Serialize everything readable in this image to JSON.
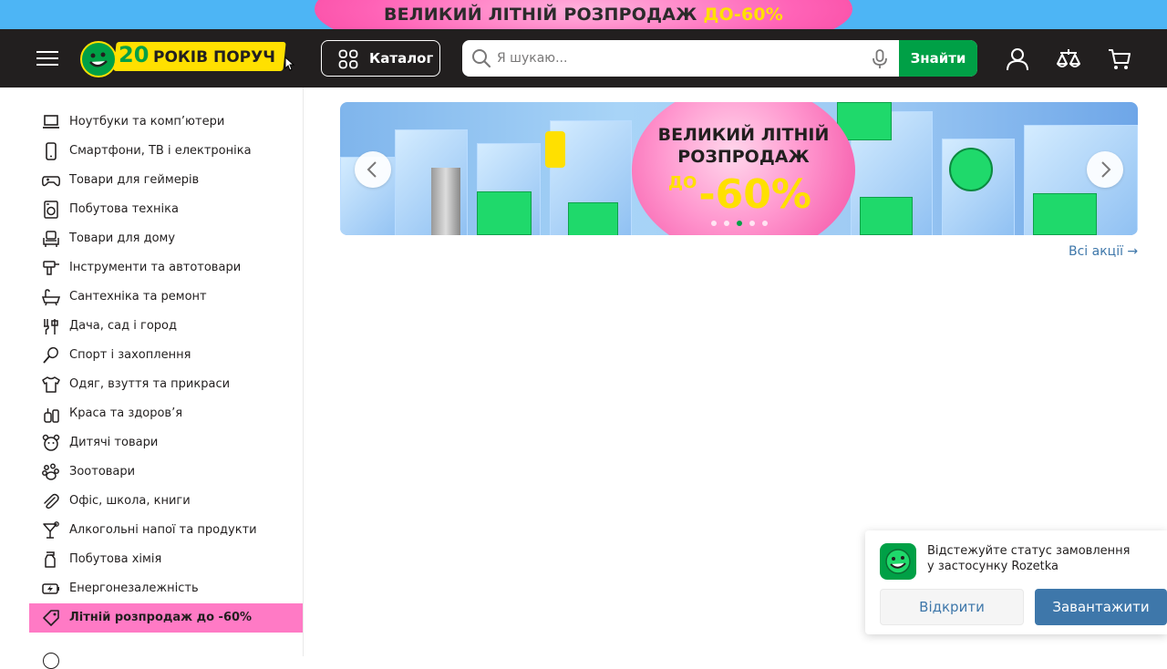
{
  "promo": {
    "text": "ВЕЛИКИЙ ЛІТНІЙ РОЗПРОДАЖ",
    "highlight": "ДО-60%"
  },
  "header": {
    "logo_number": "20",
    "logo_text": "РОКІВ ПОРУЧ",
    "catalog_label": "Каталог",
    "search_placeholder": "Я шукаю...",
    "search_button": "Знайти",
    "icons": [
      "menu-icon",
      "user-icon",
      "compare-icon",
      "cart-icon"
    ]
  },
  "sidebar": {
    "items": [
      {
        "label": "Ноутбуки та комп’ютери",
        "icon": "laptop-icon"
      },
      {
        "label": "Смартфони, ТВ і електроніка",
        "icon": "smartphone-icon"
      },
      {
        "label": "Товари для геймерів",
        "icon": "gamepad-icon"
      },
      {
        "label": "Побутова техніка",
        "icon": "washing-machine-icon"
      },
      {
        "label": "Товари для дому",
        "icon": "sofa-icon"
      },
      {
        "label": "Інструменти та автотовари",
        "icon": "drill-icon"
      },
      {
        "label": "Сантехніка та ремонт",
        "icon": "bathtub-icon"
      },
      {
        "label": "Дача, сад і город",
        "icon": "garden-fork-icon"
      },
      {
        "label": "Спорт і захоплення",
        "icon": "racket-icon"
      },
      {
        "label": "Одяг, взуття та прикраси",
        "icon": "tshirt-icon"
      },
      {
        "label": "Краса та здоров’я",
        "icon": "beauty-bottle-icon"
      },
      {
        "label": "Дитячі товари",
        "icon": "teddy-bear-icon"
      },
      {
        "label": "Зоотовари",
        "icon": "paw-icon"
      },
      {
        "label": "Офіс, школа, книги",
        "icon": "paperclip-icon"
      },
      {
        "label": "Алкогольні напої та продукти",
        "icon": "cocktail-icon"
      },
      {
        "label": "Побутова хімія",
        "icon": "spray-bottle-icon"
      },
      {
        "label": "Енергонезалежність",
        "icon": "battery-icon"
      },
      {
        "label": "Літній розпродаж до -60%",
        "icon": "tag-icon",
        "active": true
      }
    ]
  },
  "banner": {
    "line1": "ВЕЛИКИЙ ЛІТНІЙ",
    "line2": "РОЗПРОДАЖ",
    "prefix": "ДО",
    "discount": "-60%",
    "slide_count": 5,
    "active_slide": 3
  },
  "all_promos_link": "Всі акції →",
  "app_popup": {
    "line1": "Відстежуйте статус замовлення",
    "line2": "у застосунку Rozetka",
    "open_button": "Відкрити",
    "download_button": "Завантажити"
  },
  "colors": {
    "header_bg": "#221f1f",
    "brand_green": "#00a046",
    "brand_yellow": "#ffe000",
    "promo_pink": "#ff7ac5",
    "link_blue": "#3e77aa",
    "strip_blue": "#4db5f5"
  }
}
